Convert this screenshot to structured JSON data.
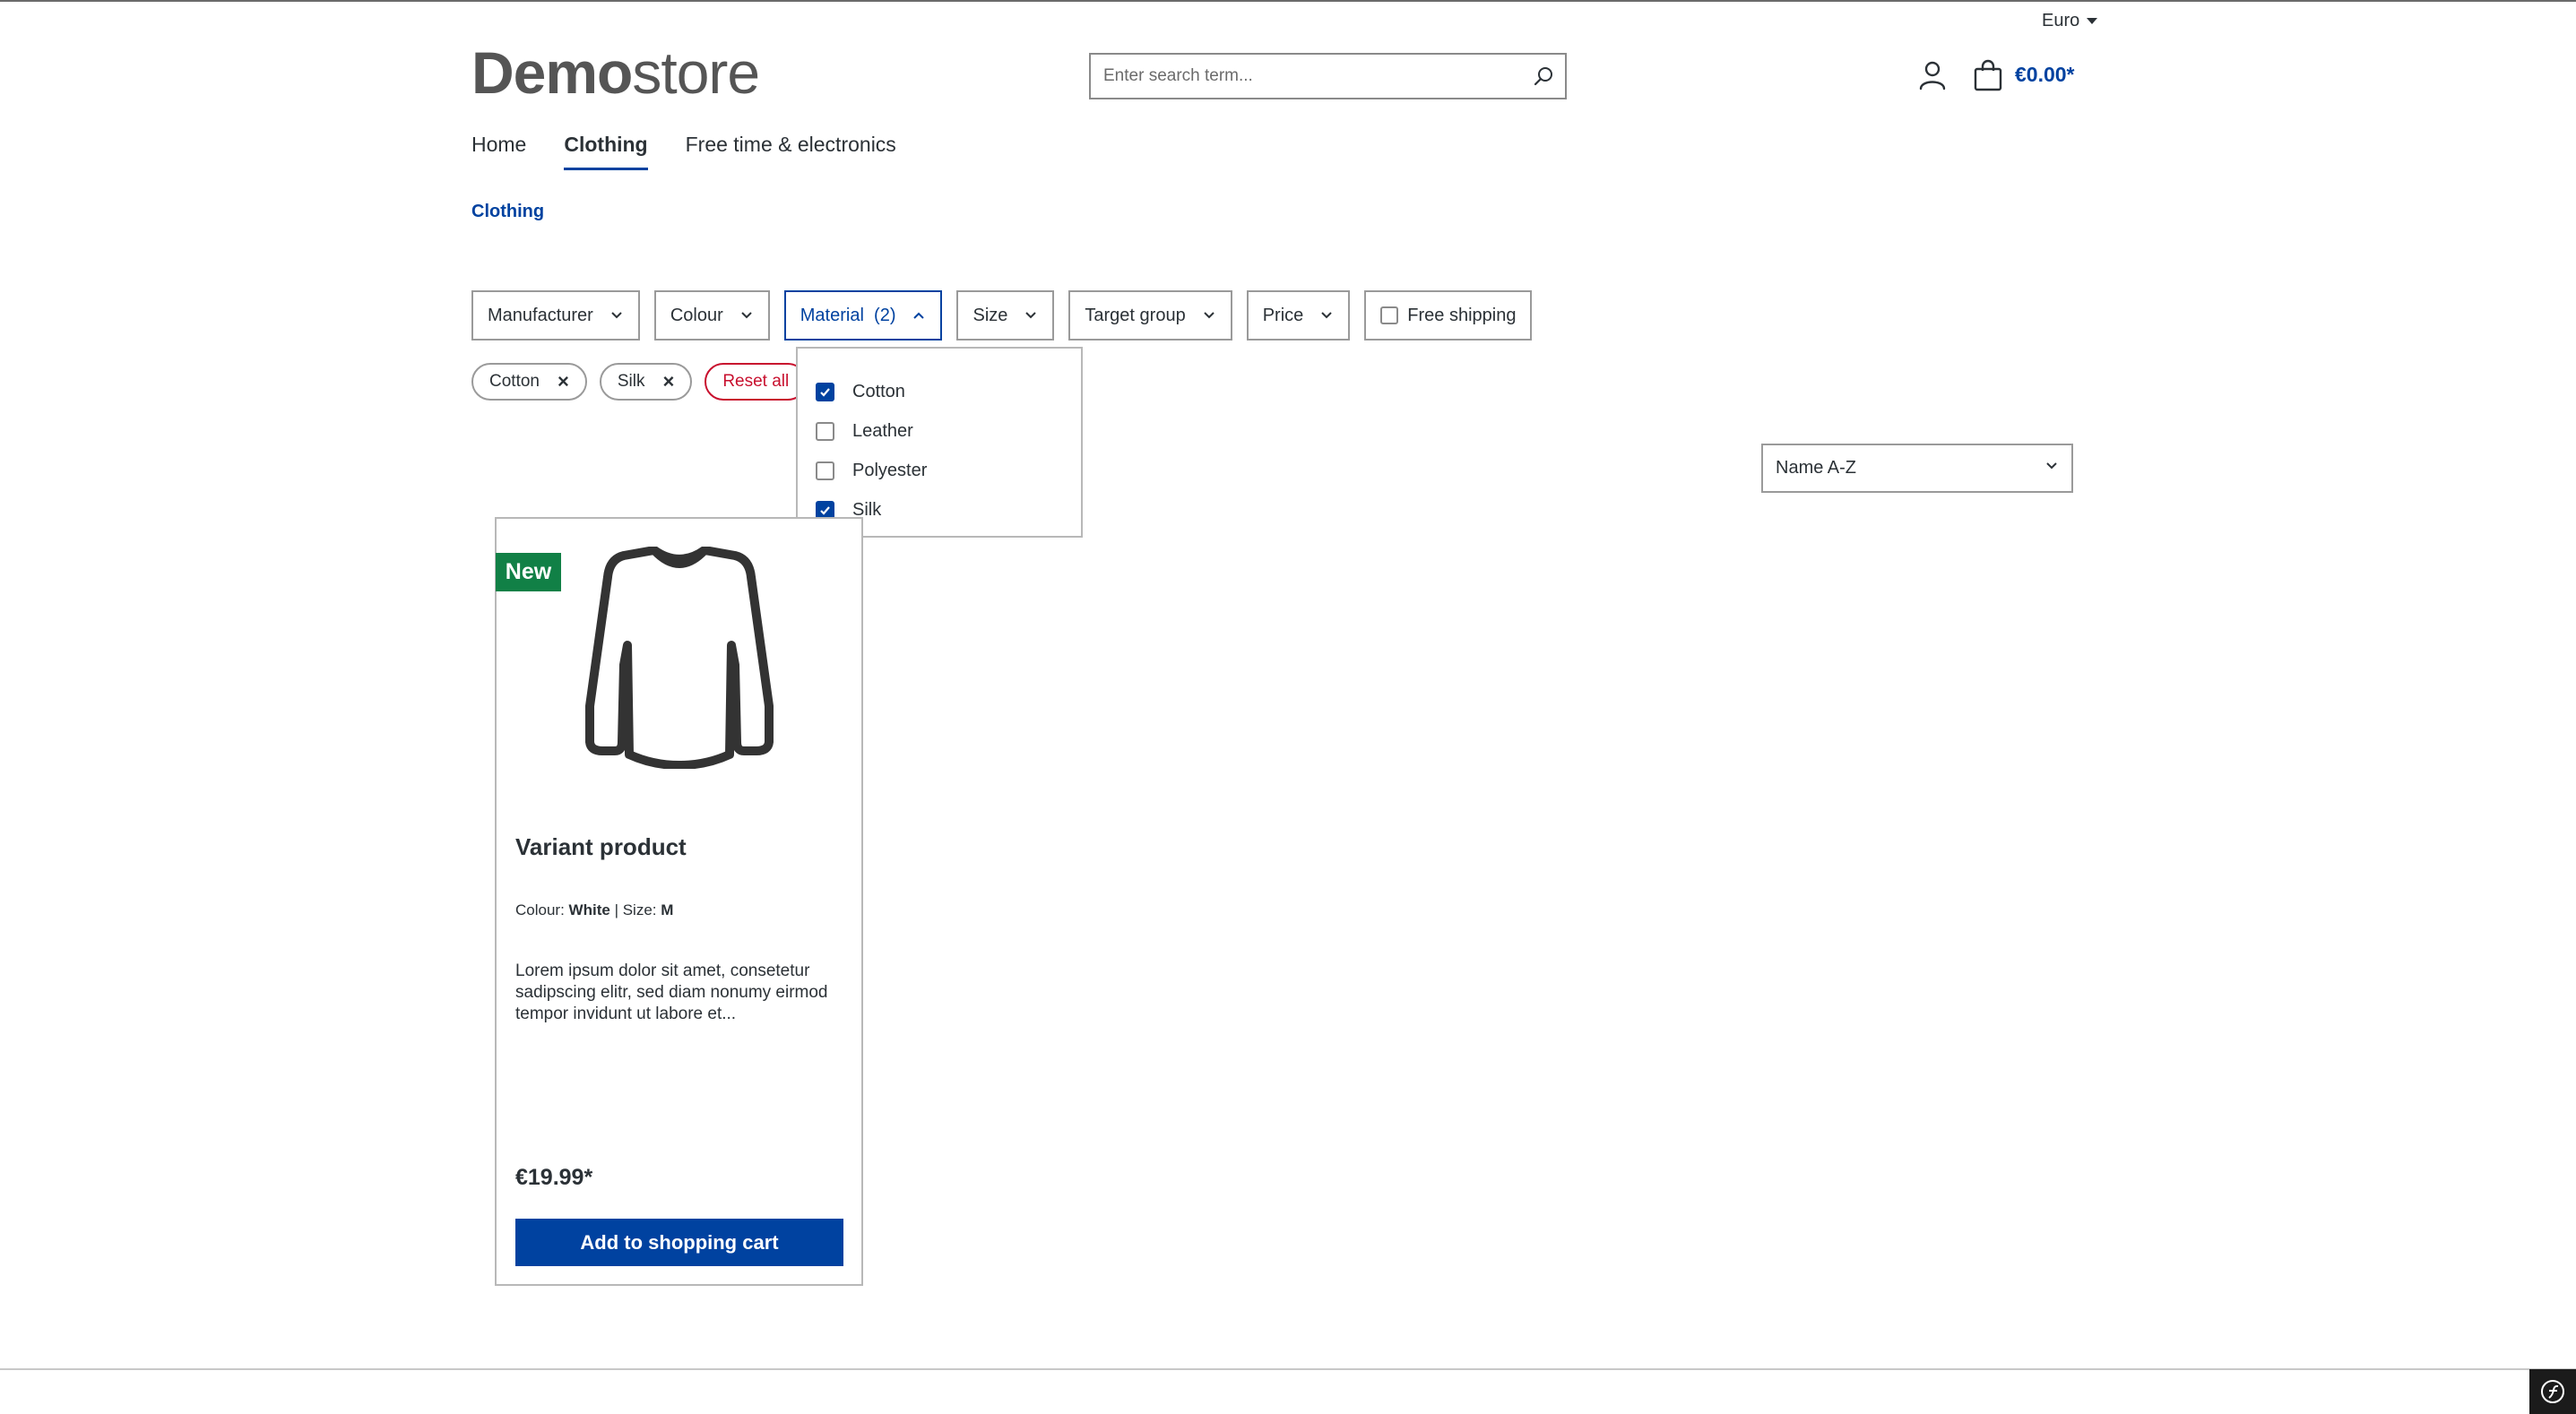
{
  "header": {
    "currency": "Euro",
    "logo_bold": "Demo",
    "logo_light": "store",
    "search_placeholder": "Enter search term...",
    "cart_total": "€0.00*"
  },
  "nav": {
    "items": [
      "Home",
      "Clothing",
      "Free time & electronics"
    ],
    "active": "Clothing"
  },
  "breadcrumb": "Clothing",
  "filters": {
    "manufacturer": "Manufacturer",
    "colour": "Colour",
    "material": "Material",
    "material_count": "(2)",
    "size": "Size",
    "target_group": "Target group",
    "price": "Price",
    "free_shipping": "Free shipping"
  },
  "active_filters": {
    "pills": [
      "Cotton",
      "Silk"
    ],
    "remove_symbol": "×",
    "reset": "Reset all"
  },
  "material_dropdown": {
    "options": [
      {
        "label": "Cotton",
        "checked": true
      },
      {
        "label": "Leather",
        "checked": false
      },
      {
        "label": "Polyester",
        "checked": false
      },
      {
        "label": "Silk",
        "checked": true
      }
    ]
  },
  "sort": {
    "selected": "Name A-Z"
  },
  "product": {
    "badge": "New",
    "name": "Variant product",
    "variant_colour_label": "Colour:",
    "variant_colour_value": "White",
    "variant_separator": "|",
    "variant_size_label": "Size:",
    "variant_size_value": "M",
    "description": "Lorem ipsum dolor sit amet, consetetur sadipscing elitr, sed diam nonumy eirmod tempor invidunt ut labore et...",
    "price": "€19.99*",
    "add_to_cart": "Add to shopping cart"
  },
  "colors": {
    "accent": "#0042a0",
    "new_badge": "#118046",
    "reset": "#c8102e",
    "text": "#2b3136"
  }
}
